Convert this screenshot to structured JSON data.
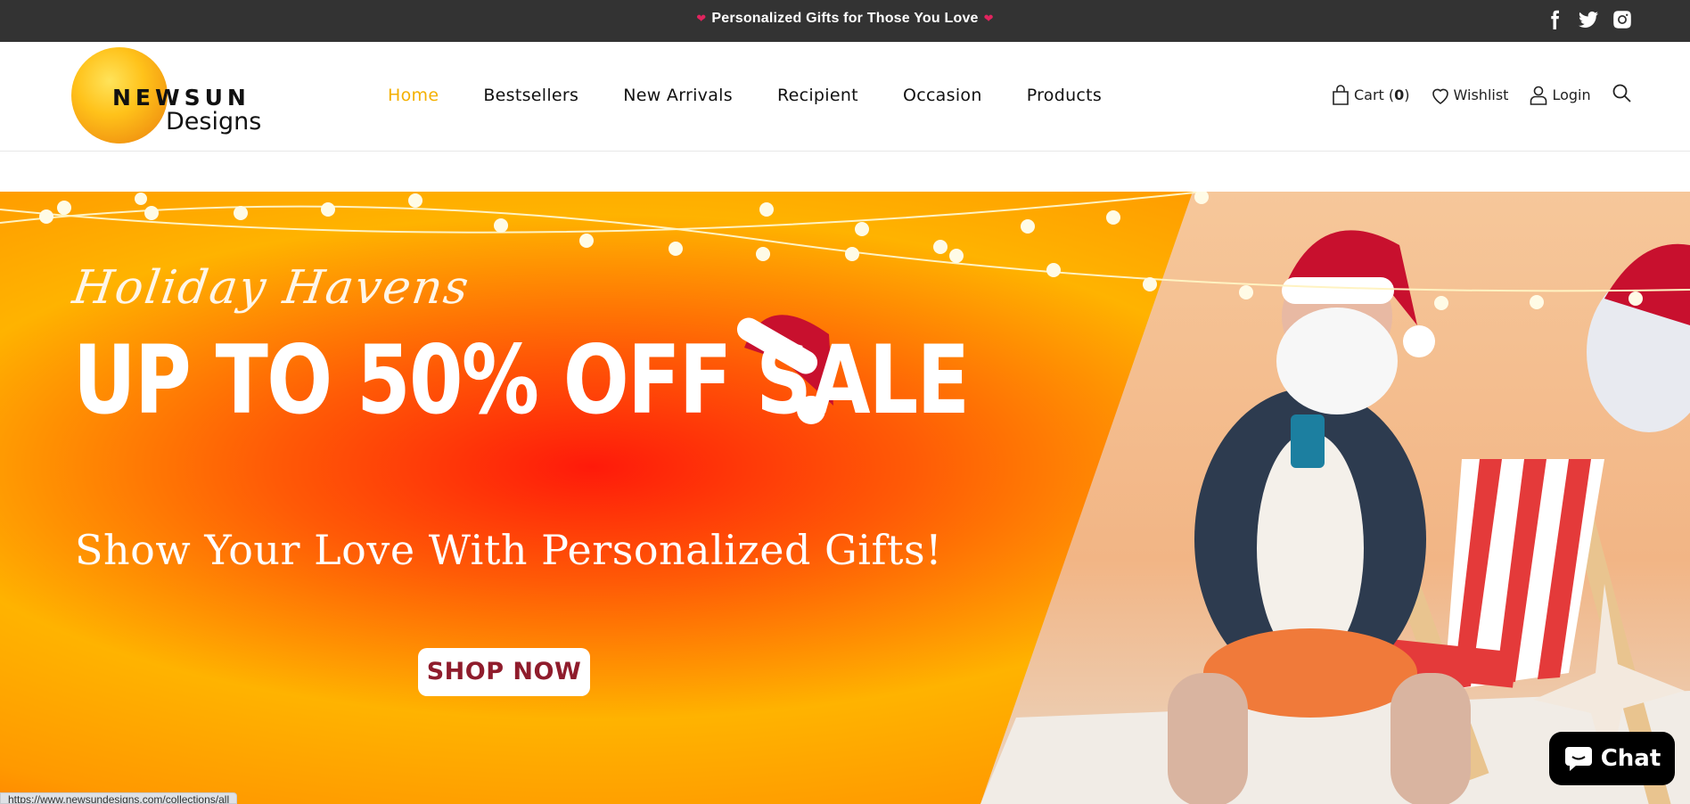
{
  "announcement": {
    "text": "Personalized Gifts for Those You Love",
    "heart_color": "#e0245e"
  },
  "socials": [
    "facebook-icon",
    "twitter-icon",
    "instagram-icon"
  ],
  "logo": {
    "line1": "NEWSUN",
    "line2": "Designs"
  },
  "nav": {
    "items": [
      {
        "label": "Home",
        "active": true
      },
      {
        "label": "Bestsellers"
      },
      {
        "label": "New Arrivals"
      },
      {
        "label": "Recipient"
      },
      {
        "label": "Occasion"
      },
      {
        "label": "Products"
      }
    ],
    "active_color": "#f4b000"
  },
  "tools": {
    "cart_label": "Cart (",
    "cart_count": "0",
    "cart_close": ")",
    "wishlist_label": "Wishlist",
    "login_label": "Login"
  },
  "hero": {
    "script_title": "Holiday Havens",
    "headline": "UP TO 50% OFF SALE",
    "subline": "Show Your Love With Personalized Gifts!",
    "button_label": "SHOP NOW",
    "button_text_color": "#8f1c2c"
  },
  "chat": {
    "label": "Chat"
  },
  "status_bar": {
    "url": "https://www.newsundesigns.com/collections/all"
  }
}
